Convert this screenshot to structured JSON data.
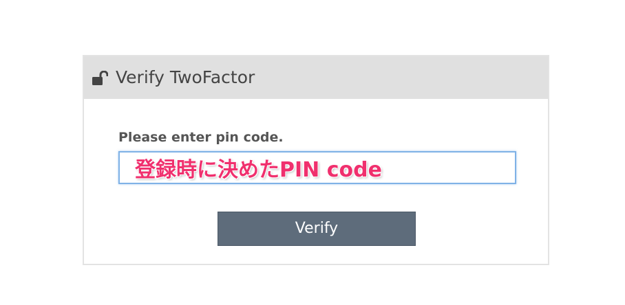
{
  "panel": {
    "title": "Verify TwoFactor",
    "icon": "unlock-icon"
  },
  "form": {
    "label": "Please enter pin code.",
    "pin_input_value": "登録時に決めたPIN code",
    "verify_label": "Verify"
  },
  "colors": {
    "header_bg": "#e0e0e0",
    "button_bg": "#5e6c7b",
    "input_text": "#f0306e",
    "input_border": "#7fb2e6"
  }
}
